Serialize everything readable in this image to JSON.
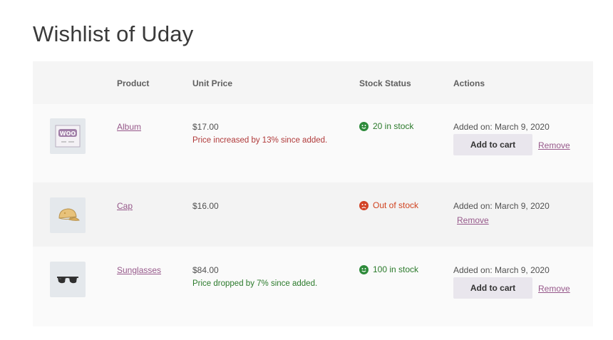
{
  "page": {
    "title": "Wishlist of Uday"
  },
  "columns": {
    "thumbnail": "",
    "product": "Product",
    "unit_price": "Unit Price",
    "stock_status": "Stock Status",
    "actions": "Actions"
  },
  "items": [
    {
      "name": "Album",
      "thumbnail_icon": "album-cover-woo-icon",
      "price": "$17.00",
      "price_note": "Price increased by 13% since added.",
      "stock": "20 in stock",
      "stock_icon": "happy-face-icon",
      "added_on": "Added on: March 9, 2020",
      "add_to_cart": "Add to cart",
      "remove": "Remove"
    },
    {
      "name": "Cap",
      "thumbnail_icon": "cap-icon",
      "price": "$16.00",
      "price_note": "",
      "stock": "Out of stock",
      "stock_icon": "sad-face-icon",
      "added_on": "Added on: March 9, 2020",
      "add_to_cart": "",
      "remove": "Remove"
    },
    {
      "name": "Sunglasses",
      "thumbnail_icon": "sunglasses-icon",
      "price": "$84.00",
      "price_note": "Price dropped by 7% since added.",
      "stock": "100 in stock",
      "stock_icon": "happy-face-icon",
      "added_on": "Added on: March 9, 2020",
      "add_to_cart": "Add to cart",
      "remove": "Remove"
    }
  ],
  "colors": {
    "link": "#96588a",
    "in_stock": "#2b7a2b",
    "out_of_stock": "#d0421f",
    "price_increase": "#b03a3a",
    "price_decrease": "#2b7a2b"
  }
}
